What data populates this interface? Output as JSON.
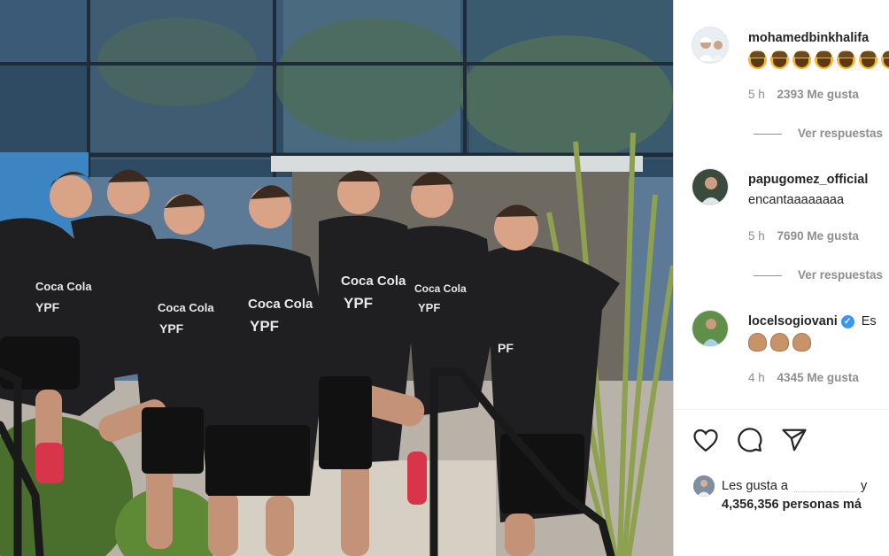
{
  "post": {
    "image_description": ""
  },
  "comments": [
    {
      "username": "mohamedbinkhalifa",
      "text": "",
      "emoji": "raising-hands",
      "emoji_count": 8,
      "time": "5 h",
      "likes": "2393 Me gusta",
      "replies_label": "Ver respuestas",
      "verified": false
    },
    {
      "username": "papugomez_official",
      "text": "encantaaaaaaaa",
      "time": "5 h",
      "likes": "7690 Me gusta",
      "replies_label": "Ver respuestas",
      "verified": false
    },
    {
      "username": "locelsogiovani",
      "text": "Es",
      "emoji": "clapping-hands",
      "emoji_count": 3,
      "time": "4 h",
      "likes": "4345 Me gusta",
      "verified": true
    }
  ],
  "actions": {
    "like_icon": "heart-icon",
    "comment_icon": "comment-icon",
    "share_icon": "send-icon"
  },
  "liked_by": {
    "prefix": "Les gusta a",
    "suffix": "y",
    "count_text": "4,356,356 personas má"
  },
  "colors": {
    "accent_verified": "#3897f0",
    "meta_gray": "#8e8e8e",
    "text": "#262626"
  }
}
